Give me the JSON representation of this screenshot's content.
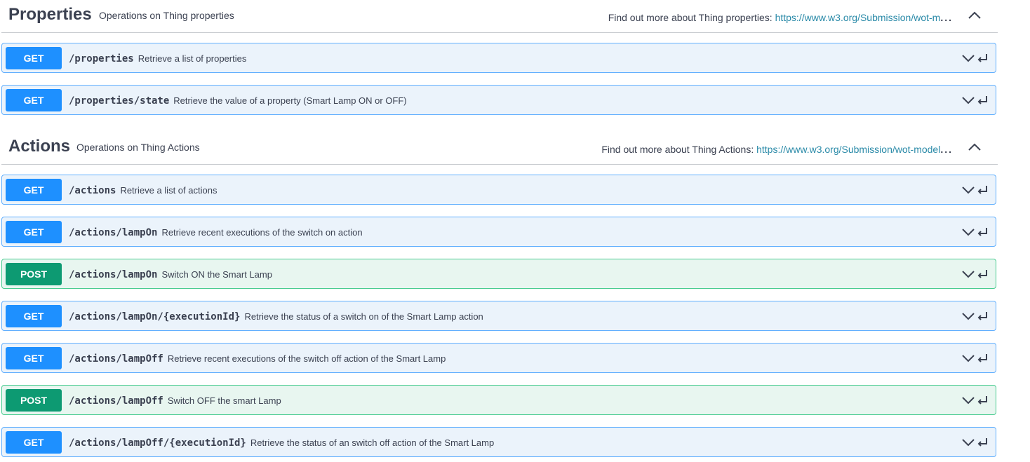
{
  "sections": [
    {
      "title": "Properties",
      "description": "Operations on Thing properties",
      "external_label": "Find out more about Thing properties:",
      "external_link": "https://www.w3.org/Submission/wot-m",
      "ellipsis": "...",
      "operations": [
        {
          "method": "GET",
          "path": "/properties",
          "summary": "Retrieve a list of properties"
        },
        {
          "method": "GET",
          "path": "/properties/state",
          "summary": "Retrieve the value of a property (Smart Lamp ON or OFF)"
        }
      ]
    },
    {
      "title": "Actions",
      "description": "Operations on Thing Actions",
      "external_label": "Find out more about Thing Actions:",
      "external_link": "https://www.w3.org/Submission/wot-model",
      "ellipsis": "...",
      "operations": [
        {
          "method": "GET",
          "path": "/actions",
          "summary": "Retrieve a list of actions"
        },
        {
          "method": "GET",
          "path": "/actions/lampOn",
          "summary": "Retrieve recent executions of the switch on action"
        },
        {
          "method": "POST",
          "path": "/actions/lampOn",
          "summary": "Switch ON the Smart Lamp"
        },
        {
          "method": "GET",
          "path": "/actions/lampOn/{executionId}",
          "summary": "Retrieve the status of a switch on of the Smart Lamp action"
        },
        {
          "method": "GET",
          "path": "/actions/lampOff",
          "summary": "Retrieve recent executions of the switch off action of the Smart Lamp"
        },
        {
          "method": "POST",
          "path": "/actions/lampOff",
          "summary": "Switch OFF the smart Lamp"
        },
        {
          "method": "GET",
          "path": "/actions/lampOff/{executionId}",
          "summary": "Retrieve the status of an switch off action of the Smart Lamp"
        }
      ]
    }
  ],
  "icons": {
    "collapse": "chevron-up-icon",
    "expand": "chevron-down-icon",
    "enter": "enter-icon"
  },
  "colors": {
    "get_accent": "#1e90ff",
    "get_bg": "#ebf3fb",
    "post_accent": "#0d9a72",
    "post_bg": "#e8f6f0"
  }
}
